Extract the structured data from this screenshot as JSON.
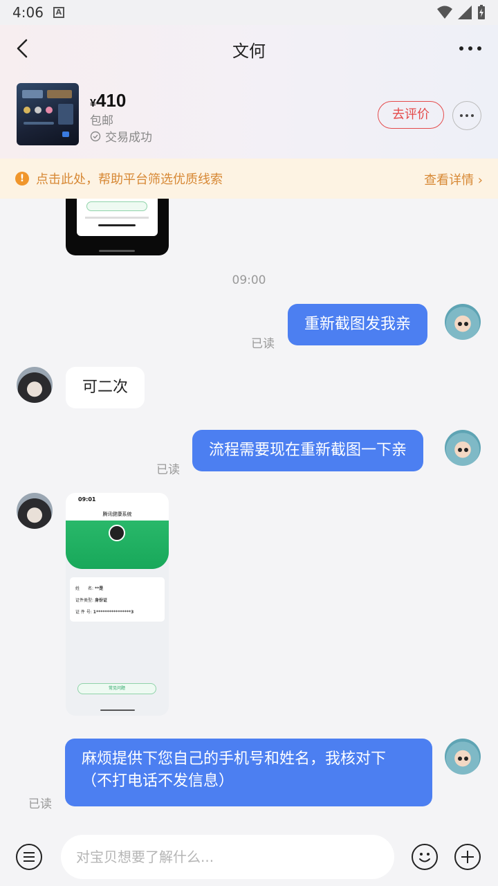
{
  "status_bar": {
    "time": "4:06",
    "notification_icon": "A"
  },
  "header": {
    "title": "文何"
  },
  "product": {
    "currency": "¥",
    "price": "410",
    "shipping": "包邮",
    "status": "交易成功",
    "review_button": "去评价"
  },
  "notice": {
    "text": "点击此处，帮助平台筛选优质线索",
    "link": "查看详情"
  },
  "chat": {
    "timestamp": "09:00",
    "read_label": "已读",
    "messages": [
      {
        "from": "me",
        "text": "重新截图发我亲",
        "read": "已读"
      },
      {
        "from": "other",
        "text": "可二次"
      },
      {
        "from": "me",
        "text": "流程需要现在重新截图一下亲",
        "read": "已读"
      },
      {
        "from": "me",
        "text_line1": "麻烦提供下您自己的手机号和姓名，我核对下",
        "text_line2": "（不打电话不发信息）",
        "read": "已读"
      }
    ],
    "screenshot": {
      "time": "09:01",
      "app_title": "腾讯健康系统",
      "name_label": "姓　　名:",
      "name_value": "**是",
      "id_type_label": "证件类型:",
      "id_type_value": "身份证",
      "id_no_label": "证 件 号:",
      "id_no_value": "1****************3",
      "faq_button": "常见问题"
    }
  },
  "composer": {
    "placeholder": "对宝贝想要了解什么..."
  },
  "colors": {
    "accent_blue": "#4c7ff1",
    "review_red": "#e44a4a",
    "notice_orange": "#d78834"
  }
}
